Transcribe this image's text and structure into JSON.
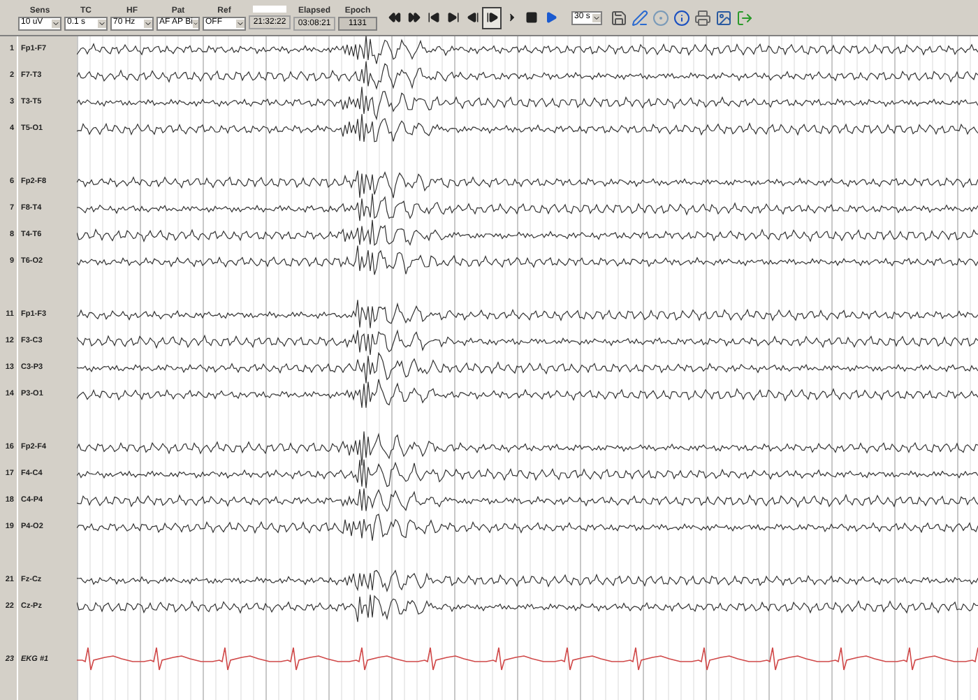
{
  "toolbar": {
    "controls": [
      {
        "label": "Sens",
        "value": "10 uV"
      },
      {
        "label": "TC",
        "value": "0.1 s"
      },
      {
        "label": "HF",
        "value": "70 Hz"
      },
      {
        "label": "Pat",
        "value": "AF AP Bi"
      },
      {
        "label": "Ref",
        "value": "OFF"
      }
    ],
    "clock": "21:32:22",
    "elapsed": {
      "label": "Elapsed",
      "value": "03:08:21"
    },
    "epoch": {
      "label": "Epoch",
      "value": "1131"
    },
    "playback_buttons": [
      {
        "kind": "rewind",
        "selected": false
      },
      {
        "kind": "forward",
        "selected": false
      },
      {
        "kind": "first",
        "selected": false
      },
      {
        "kind": "last",
        "selected": false
      },
      {
        "kind": "step-back",
        "selected": false
      },
      {
        "kind": "step-forward",
        "selected": true
      },
      {
        "kind": "next",
        "selected": false
      },
      {
        "kind": "stop",
        "selected": false
      },
      {
        "kind": "play",
        "selected": false
      }
    ],
    "page_length": "30 s",
    "tools": [
      {
        "kind": "save"
      },
      {
        "kind": "edit"
      },
      {
        "kind": "target"
      },
      {
        "kind": "info"
      },
      {
        "kind": "print"
      },
      {
        "kind": "image"
      },
      {
        "kind": "exit"
      }
    ]
  },
  "channel_groups": [
    {
      "channels": [
        {
          "number": "1",
          "name": "Fp1-F7",
          "kind": "eeg"
        },
        {
          "number": "2",
          "name": "F7-T3",
          "kind": "eeg"
        },
        {
          "number": "3",
          "name": "T3-T5",
          "kind": "eeg"
        },
        {
          "number": "4",
          "name": "T5-O1",
          "kind": "eeg"
        }
      ]
    },
    {
      "channels": [
        {
          "number": "6",
          "name": "Fp2-F8",
          "kind": "eeg"
        },
        {
          "number": "7",
          "name": "F8-T4",
          "kind": "eeg"
        },
        {
          "number": "8",
          "name": "T4-T6",
          "kind": "eeg"
        },
        {
          "number": "9",
          "name": "T6-O2",
          "kind": "eeg"
        }
      ]
    },
    {
      "channels": [
        {
          "number": "11",
          "name": "Fp1-F3",
          "kind": "eeg"
        },
        {
          "number": "12",
          "name": "F3-C3",
          "kind": "eeg"
        },
        {
          "number": "13",
          "name": "C3-P3",
          "kind": "eeg"
        },
        {
          "number": "14",
          "name": "P3-O1",
          "kind": "eeg"
        }
      ]
    },
    {
      "channels": [
        {
          "number": "16",
          "name": "Fp2-F4",
          "kind": "eeg"
        },
        {
          "number": "17",
          "name": "F4-C4",
          "kind": "eeg"
        },
        {
          "number": "18",
          "name": "C4-P4",
          "kind": "eeg"
        },
        {
          "number": "19",
          "name": "P4-O2",
          "kind": "eeg"
        }
      ]
    },
    {
      "channels": [
        {
          "number": "21",
          "name": "Fz-Cz",
          "kind": "eeg"
        },
        {
          "number": "22",
          "name": "Cz-Pz",
          "kind": "eeg"
        }
      ]
    },
    {
      "channels": [
        {
          "number": "23",
          "name": "EKG #1",
          "kind": "ekg"
        }
      ]
    }
  ]
}
